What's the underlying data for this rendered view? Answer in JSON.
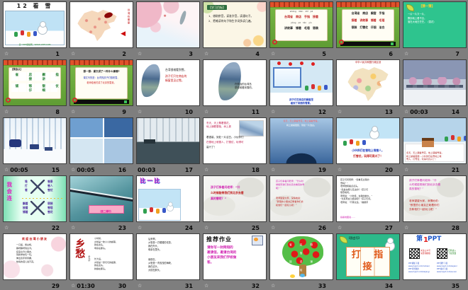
{
  "page": {
    "app_context": "幻灯片浏览视图",
    "background": "#7e7e7e",
    "star_glyph": "☆",
    "star_color": "#e8e8e8",
    "number_color": "#0a0a0a",
    "slide_count": 35
  },
  "slides": [
    {
      "n": 1,
      "star": true,
      "time": null,
      "texts": [
        "12 看 雪",
        "第一PPT模板网：WWW.1PPT.COM"
      ],
      "icons": [
        "snowman-icon",
        "kids-icon"
      ]
    },
    {
      "n": 2,
      "star": true,
      "time": null,
      "texts": [
        "台湾在哪里"
      ],
      "icons": [
        "china-map-icon",
        "red-arrow-icon"
      ]
    },
    {
      "n": 3,
      "star": true,
      "time": null,
      "texts": [],
      "icons": [
        "taiwan-sliver-icon"
      ]
    },
    {
      "n": 4,
      "star": true,
      "time": null,
      "texts": [
        "【学习目标】",
        "1、借助拼音，读准字音，读通句子。\n2、把难读的句子和生字词多读几遍。"
      ],
      "icons": []
    },
    {
      "n": 5,
      "star": true,
      "time": null,
      "texts": [
        "shěng　diàn　zhǐ　jiē",
        "台湾省　商店　手指　接着",
        "jiǎng　pū　tǎn　yín",
        "讲故事　铺着　毛毯　银装"
      ],
      "icons": [
        "flower-icon"
      ]
    },
    {
      "n": 6,
      "star": false,
      "time": null,
      "texts": [
        "台湾省　商店　橱窗　手指",
        "接着　讲故事　铺着　毛毯",
        "银装　打雪仗　仔细　洁白"
      ],
      "icons": [
        "flower-icon",
        "black-strip-icon"
      ]
    },
    {
      "n": 7,
      "star": true,
      "time": null,
      "texts": [
        "【猜一猜】",
        "一片一片又一片，\n飘到地上看不见。\n落在大地白茫茫。（雪花）"
      ],
      "icons": [
        "leaf-icon"
      ]
    },
    {
      "n": 8,
      "star": true,
      "time": null,
      "texts": [
        "【我会认】",
        "省 店 橱 指 接 讲",
        "铺 毯 银 仗 仔 细"
      ],
      "icons": [
        "card-grid-icon",
        "flower-icon"
      ]
    },
    {
      "n": 9,
      "star": true,
      "time": null,
      "texts": [
        "想一想：课文讲了一件什么事情?",
        "课文写的是：台湾的孩子们想看雪，",
        "老师给他们讲了北京的雪景。"
      ],
      "icons": [
        "flower-icon",
        "black-strip-icon"
      ]
    },
    {
      "n": 10,
      "star": true,
      "time": null,
      "texts": [
        "台湾很难看到雪，",
        "孩子们只在商店的\n橱窗里见过雪。"
      ],
      "icons": [
        "taiwan-photo-icon"
      ]
    },
    {
      "n": 11,
      "star": true,
      "time": null,
      "texts": [
        "在很远的台湾岛\n是很难看到雪的。"
      ],
      "icons": [
        "taiwan-photo-icon"
      ]
    },
    {
      "n": 12,
      "star": true,
      "time": null,
      "texts": [
        "孩子们在商店的橱窗里\n看到了美丽的雪景。"
      ],
      "icons": [
        "shop-window-icon",
        "lanterns-icon",
        "kids-icon"
      ]
    },
    {
      "n": 13,
      "star": true,
      "time": null,
      "texts": [
        "中华人民共和国行政区划"
      ],
      "icons": [
        "china-map-icon"
      ]
    },
    {
      "n": 14,
      "star": true,
      "time": "00:03",
      "texts": [],
      "icons": []
    },
    {
      "n": 15,
      "star": true,
      "time": "00:05",
      "texts": [],
      "icons": []
    },
    {
      "n": 16,
      "star": true,
      "time": "00:05",
      "texts": [],
      "icons": []
    },
    {
      "n": 17,
      "star": false,
      "time": "00:03",
      "texts": [],
      "icons": []
    },
    {
      "n": 18,
      "star": true,
      "time": null,
      "texts": [
        "冬天，天上飘着雪花，\n地上铺着雪毯，树上披",
        "着银装，到处一片洁白。小伙伴们",
        "在雪地上堆雪人，打雪仗，玩得可",
        "高兴了！"
      ],
      "icons": [
        "photo-block-icon"
      ]
    },
    {
      "n": 19,
      "star": true,
      "time": null,
      "texts": [
        "冬天，天上飘着雪花，地上铺着雪毯，",
        "树上披着银装，到处一片洁白。"
      ],
      "icons": []
    },
    {
      "n": 20,
      "star": true,
      "time": null,
      "texts": [
        "小伙伴们在雪地上堆雪人，",
        "打雪仗，玩得可高兴了！"
      ],
      "icons": [
        "snowman-icon",
        "kids-icon"
      ]
    },
    {
      "n": 21,
      "star": true,
      "time": null,
      "texts": [
        "冬天，天上飘着雪花，地上铺着雪毯，\n树上披着银装…小伙伴们在雪地上堆\n雪人，打雪仗，玩得可高兴了！"
      ],
      "icons": [
        "house-icon",
        "kids-icon"
      ]
    },
    {
      "n": 22,
      "star": true,
      "time": null,
      "texts": [
        "我会连",
        "堆\n打\n看",
        "雪景\n雪人\n雪仗",
        "飘着\n披着\n铺着",
        "银装\n雪毯\n雪花"
      ],
      "icons": [
        "match-lines-top-icon",
        "match-lines-bottom-icon"
      ]
    },
    {
      "n": 23,
      "star": true,
      "time": null,
      "texts": [
        "（第二课时）"
      ],
      "icons": [
        "branch-icon",
        "pink-label-icon"
      ]
    },
    {
      "n": 24,
      "star": true,
      "time": null,
      "texts": [
        "比一比"
      ],
      "icons": [
        "kids-icon",
        "snowman-icon"
      ]
    },
    {
      "n": 25,
      "star": true,
      "time": null,
      "texts": [
        "孩子们争着问老师：“什",
        "么时候能带我们到北京去看",
        "真的雪呢？”"
      ],
      "icons": []
    },
    {
      "n": 26,
      "star": true,
      "time": null,
      "texts": [
        "孩子们争着问老师：“什么时\n候能带我们到北京去看真的雪\n呢？”",
        "老师望望大家，深情地说：\n“那里的小朋友正盼着你们去\n和他们一起玩儿呢！”"
      ],
      "icons": []
    },
    {
      "n": 27,
      "star": true,
      "time": null,
      "texts": [
        "孩子们问老师：“您看见过真的\n雪吗？”\n老师微笑着点点头。\n“您是在哪儿见过的？”孩子们\n惊奇地问。\n老师说：“小时候，在我的故乡。”\n“北京离这儿很远吧？”孩子们问。\n老师说：“不算太远。”她顺手",
        "指着地图说……"
      ],
      "icons": []
    },
    {
      "n": 28,
      "star": true,
      "time": null,
      "texts": [
        "孩子们争着问老师：“什\n么时候能带我们到北京去看\n真的雪呢？”",
        "老师望望大家，深情地说：\n“那里的小朋友正盼着你们\n去和他们一起玩儿呢！”"
      ],
      "icons": []
    },
    {
      "n": 29,
      "star": false,
      "time": null,
      "texts": [
        "欢迎台湾小朋友",
        "一只船，扬白帆，\n飘呀飘呀到台湾。\n接来台湾小朋友，\n到我学校玩一玩。\n伸出双手紧紧握，\n热情的话儿说不完。"
      ],
      "icons": []
    },
    {
      "n": 30,
      "star": true,
      "time": "01:30",
      "texts": [
        "乡愁",
        "余光中",
        "小时候，\n乡愁是一枚小小的邮票，\n我在这头，\n母亲在那头。",
        "长大后，\n乡愁是一张窄窄的船票，\n我在这头，\n新娘在那头。"
      ],
      "icons": []
    },
    {
      "n": 31,
      "star": true,
      "time": null,
      "texts": [
        "后来啊，\n乡愁是一方矮矮的坟墓，\n我在外头，\n母亲在里头。",
        "而现在，\n乡愁是一湾浅浅的海峡，\n我在这头，\n大陆在那头。"
      ],
      "icons": []
    },
    {
      "n": 32,
      "star": true,
      "time": null,
      "texts": [
        "推荐作业",
        "请你写一封简短的\n邀请信，邀请台湾的\n小朋友来我们学校做\n客。"
      ],
      "icons": [
        "computer-icon"
      ]
    },
    {
      "n": 33,
      "star": true,
      "time": null,
      "texts": [
        "省 店 橱 指\n接 讲 铺 毯"
      ],
      "icons": [
        "apple-tree-icon",
        "duck-icon"
      ]
    },
    {
      "n": 34,
      "star": false,
      "time": null,
      "texts": [
        "【我会写】",
        "打 指 接"
      ],
      "icons": [
        "leaf-icon",
        "snowman-icon"
      ]
    },
    {
      "n": 35,
      "star": false,
      "time": null,
      "texts": [
        "第",
        "1",
        "PPT",
        "关注公众号\n免费领模板",
        "扫码进入\n下载页面",
        "PPT模板下载\nwww.1ppt.com/moban/\nPPT背景图片\nwww.1ppt.com/beijing/",
        "PPT课件下载\nwww.1ppt.com/kejian/\nPPT素材下载\nwww.1ppt.com/sucai/"
      ],
      "icons": [
        "qr-left-icon",
        "qr-right-icon"
      ]
    }
  ]
}
